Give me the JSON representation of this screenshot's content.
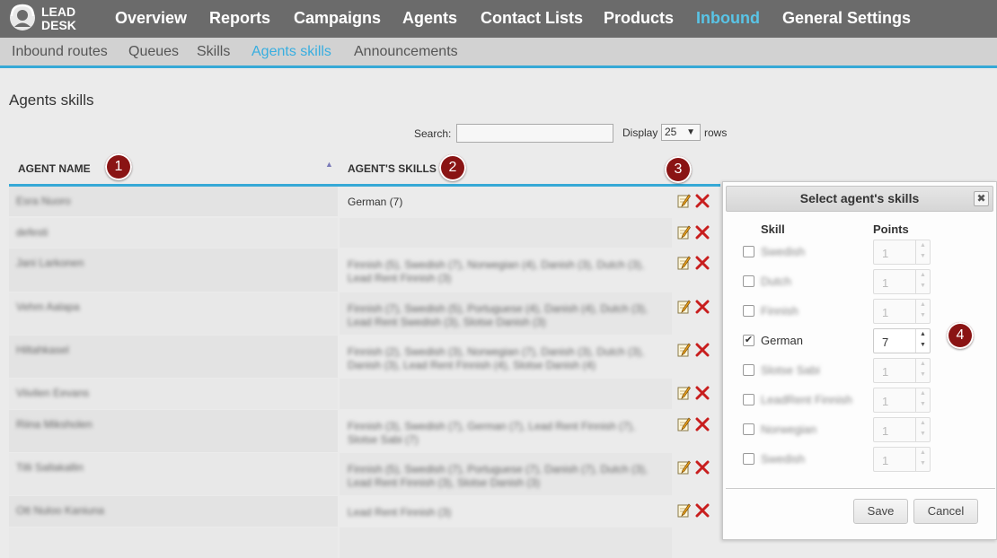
{
  "app": {
    "logo_line1": "LEAD",
    "logo_line2": "DESK"
  },
  "topnav": {
    "items": [
      "Overview",
      "Reports",
      "Campaigns",
      "Agents",
      "Contact Lists",
      "Products",
      "Inbound",
      "General Settings"
    ],
    "active": "Inbound"
  },
  "subnav": {
    "items": [
      "Inbound routes",
      "Queues",
      "Skills",
      "Agents skills",
      "Announcements"
    ],
    "active": "Agents skills"
  },
  "page": {
    "title": "Agents skills",
    "search_label": "Search:",
    "search_value": "",
    "display_label": "Display",
    "rows_value": "25",
    "rows_label": "rows"
  },
  "table": {
    "columns": [
      "AGENT NAME",
      "AGENT'S SKILLS"
    ],
    "rows": [
      {
        "agent": "Esra Nuoro",
        "skills": "German (7)",
        "skills_visible": true
      },
      {
        "agent": "defesti",
        "skills": "",
        "skills_visible": false
      },
      {
        "agent": "Jani Larkonen",
        "skills": "Finnish (5), Swedish (7), Norwegian (4), Danish (3), Dutch (3), ",
        "skills2": "Lead Rent Finnish (3)",
        "skills_visible": false
      },
      {
        "agent": "Vehm Aalapa",
        "skills": "Finnish (7), Swedish (5), Portuguese (4), Danish (4), Dutch (3), ",
        "skills2": "Lead Rent Swedish (3), Slotse Danish (3)",
        "skills_visible": false
      },
      {
        "agent": "Hiltahkasel",
        "skills": "Finnish (2), Swedish (3), Norwegian (7), Danish (3), Dutch (3), ",
        "skills2": "Danish (3), Lead Rent Finnish (4), Slotse Danish (4)",
        "skills_visible": false
      },
      {
        "agent": "Viivilen Eevans",
        "skills": "",
        "skills_visible": false
      },
      {
        "agent": "Riina Miksholen",
        "skills": "Finnish (3), Swedish (7), German (7), Lead Rent Finnish (7), ",
        "skills2": "Slotse Sabi (7)",
        "skills_visible": false
      },
      {
        "agent": "Tilli Sallakallin",
        "skills": "Finnish (5), Swedish (7), Portuguese (7), Danish (7), Dutch (3), ",
        "skills2": "Lead Rent Finnish (3), Slotse Danish (3)",
        "skills_visible": false
      },
      {
        "agent": "Ott Nuloo Kaniuna",
        "skills": "Lead Rent Finnish (3)",
        "skills_visible": false
      },
      {
        "agent": "",
        "skills": "",
        "skills_visible": false
      }
    ]
  },
  "badges": [
    "1",
    "2",
    "3",
    "4"
  ],
  "dialog": {
    "title": "Select agent's skills",
    "close_label": "✖",
    "col_skill": "Skill",
    "col_points": "Points",
    "skills": [
      {
        "name": "Swedish",
        "checked": false,
        "points": "1",
        "visible": false
      },
      {
        "name": "Dutch",
        "checked": false,
        "points": "1",
        "visible": false
      },
      {
        "name": "Finnish",
        "checked": false,
        "points": "1",
        "visible": false
      },
      {
        "name": "German",
        "checked": true,
        "points": "7",
        "visible": true
      },
      {
        "name": "Slotse Sabi",
        "checked": false,
        "points": "1",
        "visible": false
      },
      {
        "name": "LeadRent Finnish",
        "checked": false,
        "points": "1",
        "visible": false
      },
      {
        "name": "Norwegian",
        "checked": false,
        "points": "1",
        "visible": false
      },
      {
        "name": "Swedish",
        "checked": false,
        "points": "1",
        "visible": false
      }
    ],
    "save_label": "Save",
    "cancel_label": "Cancel"
  }
}
